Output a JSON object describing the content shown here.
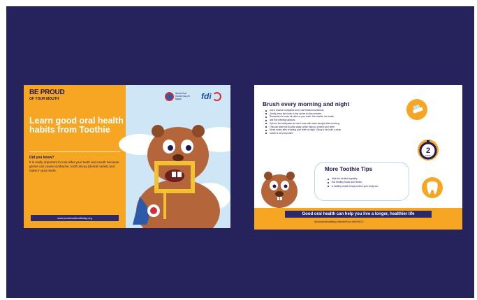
{
  "colors": {
    "slide_bg": "#26235c",
    "accent": "#f6a623",
    "navy": "#1d1a55",
    "sky": "#cfe6f7"
  },
  "card1": {
    "brand_line1": "BE PROUD",
    "brand_line2": "OF YOUR MOUTH",
    "headline": "Learn good oral health habits from Toothie",
    "did_you_know": "Did you know?",
    "body": "It is really important to look after your teeth and mouth because germs can cause toothache, tooth decay (dental caries) and holes in your teeth.",
    "url": "www.worldoralhealthday.org",
    "logo_whd": "World Oral Health Day 20 March",
    "logo_fdi": "fdi"
  },
  "card2": {
    "title": "Brush every morning and night",
    "steps": [
      "Use a fluoride toothpaste and a soft bristled toothbrush.",
      "Gently move the brush in tiny circles for two minutes.",
      "Remember to brush all sides of your teeth: the outside, the inside",
      "and the chewing surfaces.",
      "Spit out the toothpaste but don't rinse with water straight after brushing.",
      "This can wash the fluoride away, which helps to protect your teeth.",
      "Never snack after brushing your teeth at night. Going to bed with a clean",
      "mouth is very important."
    ],
    "tips_title": "More Toothie Tips",
    "tips": [
      "Visit the dentist regularly.",
      "Eat healthy foods and drinks.",
      "A healthy mouth helps protect your body too."
    ],
    "timer_value": "2",
    "timer_unit": "MINS",
    "banner": "Good oral health can help you live a longer, healthier life",
    "handle": "@worldoralhealthday  #MouthProud  #WOHD22"
  }
}
